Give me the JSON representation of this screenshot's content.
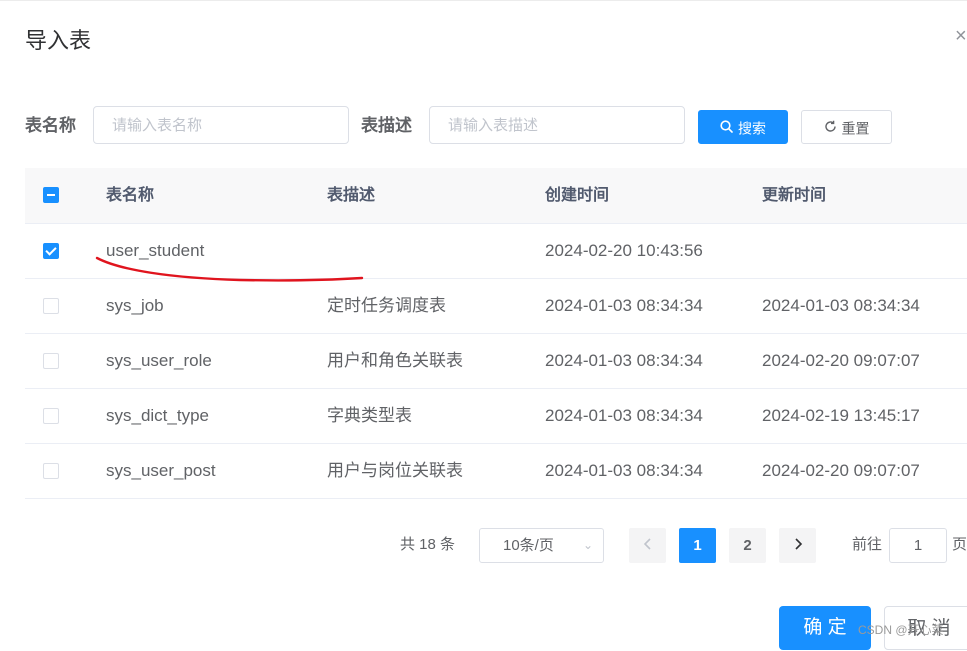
{
  "dialog": {
    "title": "导入表",
    "close_icon": "close-icon"
  },
  "filters": {
    "table_name_label": "表名称",
    "table_name_placeholder": "请输入表名称",
    "table_desc_label": "表描述",
    "table_desc_placeholder": "请输入表描述",
    "search_label": "搜索",
    "reset_label": "重置"
  },
  "table": {
    "columns": [
      "表名称",
      "表描述",
      "创建时间",
      "更新时间"
    ],
    "header_checkbox_state": "indeterminate",
    "rows": [
      {
        "checked": true,
        "name": "user_student",
        "desc": "",
        "created": "2024-02-20 10:43:56",
        "updated": ""
      },
      {
        "checked": false,
        "name": "sys_job",
        "desc": "定时任务调度表",
        "created": "2024-01-03 08:34:34",
        "updated": "2024-01-03 08:34:34"
      },
      {
        "checked": false,
        "name": "sys_user_role",
        "desc": "用户和角色关联表",
        "created": "2024-01-03 08:34:34",
        "updated": "2024-02-20 09:07:07"
      },
      {
        "checked": false,
        "name": "sys_dict_type",
        "desc": "字典类型表",
        "created": "2024-01-03 08:34:34",
        "updated": "2024-02-19 13:45:17"
      },
      {
        "checked": false,
        "name": "sys_user_post",
        "desc": "用户与岗位关联表",
        "created": "2024-01-03 08:34:34",
        "updated": "2024-02-20 09:07:07"
      }
    ]
  },
  "pagination": {
    "total": "共 18 条",
    "page_size": "10条/页",
    "pages": [
      "1",
      "2"
    ],
    "current_page": "1",
    "goto_label": "前往",
    "goto_value": "1",
    "goto_suffix": "页"
  },
  "footer": {
    "confirm_label": "确 定",
    "cancel_label": "取 消"
  },
  "watermark": "CSDN @开心菜",
  "colors": {
    "primary": "#1890ff",
    "annotation": "#e0141e"
  }
}
